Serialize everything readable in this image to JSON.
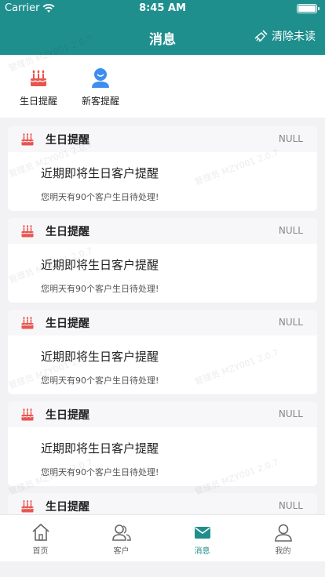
{
  "status_bar": {
    "carrier": "Carrier",
    "time": "8:45 AM"
  },
  "header": {
    "title": "消息",
    "clear_label": "清除未读"
  },
  "shortcuts": [
    {
      "label": "生日提醒",
      "icon": "birthday-cake-icon"
    },
    {
      "label": "新客提醒",
      "icon": "new-customer-icon"
    }
  ],
  "messages": [
    {
      "category": "生日提醒",
      "status": "NULL",
      "title": "近期即将生日客户提醒",
      "text": "您明天有90个客户生日待处理!"
    },
    {
      "category": "生日提醒",
      "status": "NULL",
      "title": "近期即将生日客户提醒",
      "text": "您明天有90个客户生日待处理!"
    },
    {
      "category": "生日提醒",
      "status": "NULL",
      "title": "近期即将生日客户提醒",
      "text": "您明天有90个客户生日待处理!"
    },
    {
      "category": "生日提醒",
      "status": "NULL",
      "title": "近期即将生日客户提醒",
      "text": "您明天有90个客户生日待处理!"
    },
    {
      "category": "生日提醒",
      "status": "NULL",
      "title": "",
      "text": ""
    }
  ],
  "watermark": "管理员 MZY001 2.0.7",
  "tabs": [
    {
      "label": "首页",
      "icon": "home-icon"
    },
    {
      "label": "客户",
      "icon": "customers-icon"
    },
    {
      "label": "消息",
      "icon": "message-icon"
    },
    {
      "label": "我的",
      "icon": "profile-icon"
    }
  ],
  "colors": {
    "brand": "#1f8f8e",
    "cake": "#e9544f",
    "new_customer": "#3d8ef0"
  }
}
